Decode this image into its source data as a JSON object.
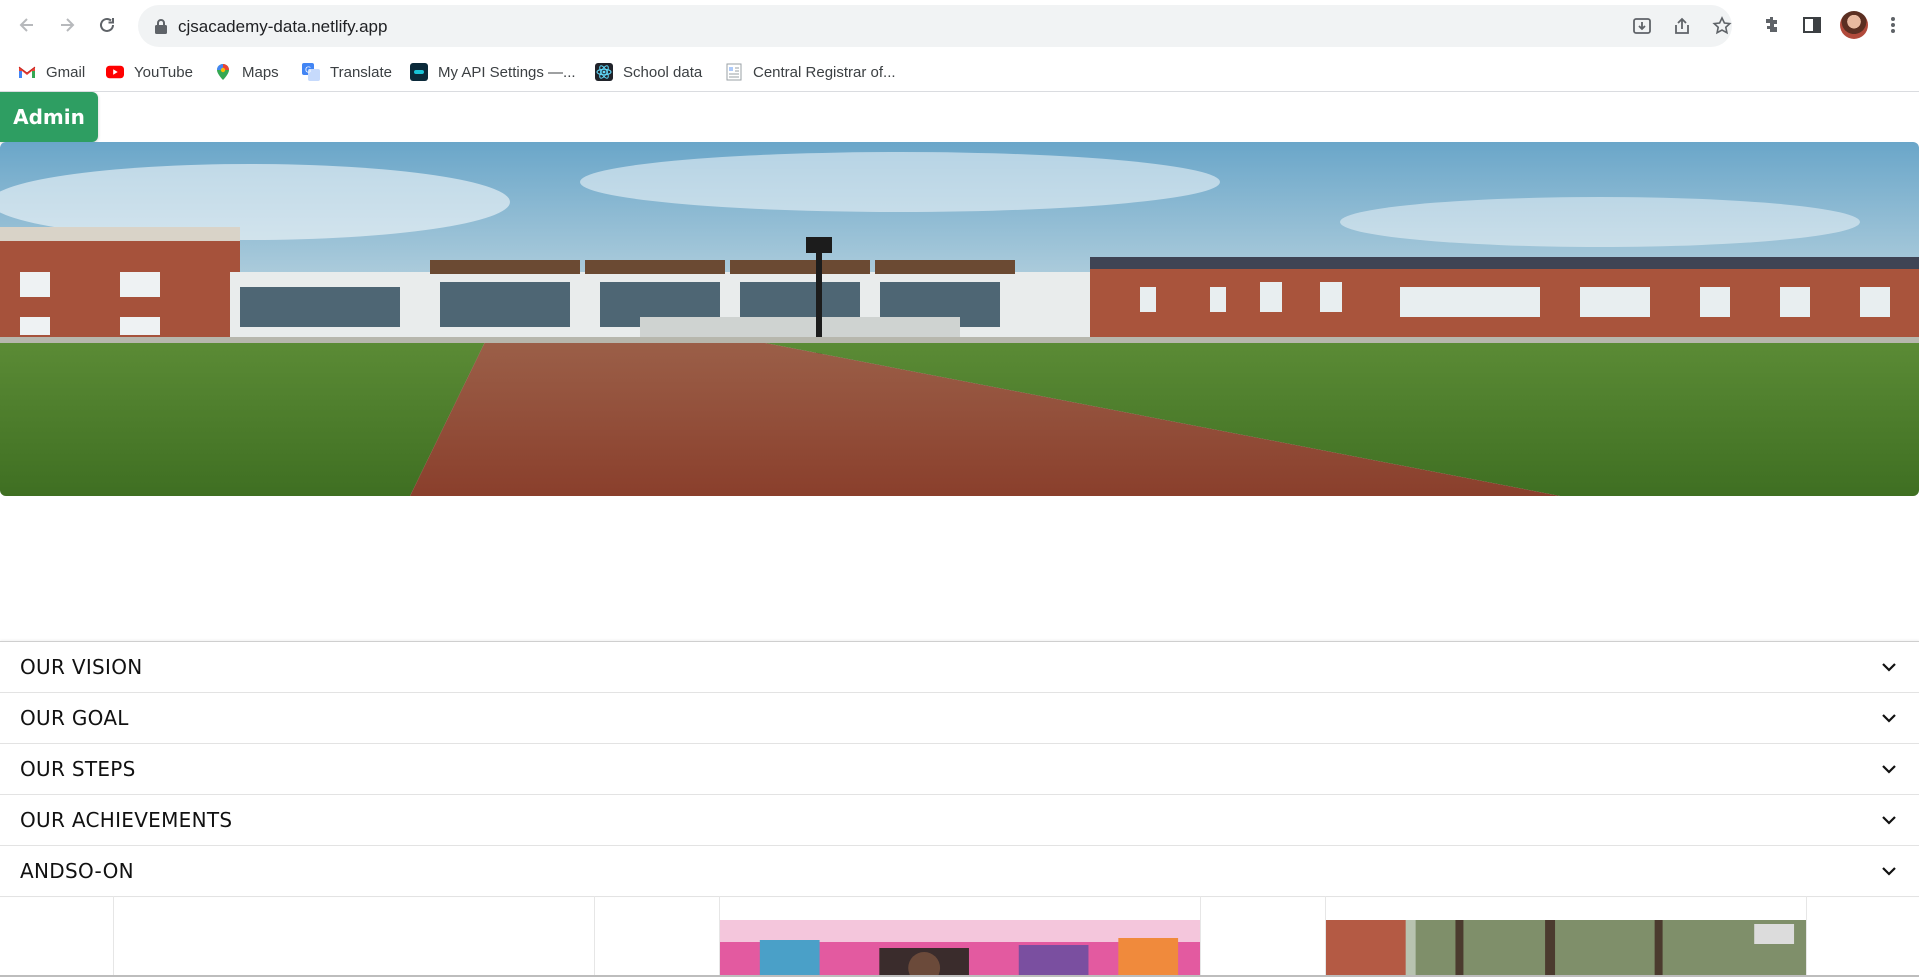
{
  "browser": {
    "url": "cjsacademy-data.netlify.app",
    "bookmarks": [
      {
        "label": "Gmail",
        "icon": "gmail-icon"
      },
      {
        "label": "YouTube",
        "icon": "youtube-icon"
      },
      {
        "label": "Maps",
        "icon": "maps-icon"
      },
      {
        "label": "Translate",
        "icon": "translate-icon"
      },
      {
        "label": "My API Settings —...",
        "icon": "api-icon"
      },
      {
        "label": "School data",
        "icon": "react-icon"
      },
      {
        "label": "Central Registrar of...",
        "icon": "document-icon"
      }
    ]
  },
  "page": {
    "admin_label": "Admin",
    "accordion": [
      {
        "label": "OUR VISION"
      },
      {
        "label": "OUR GOAL"
      },
      {
        "label": "OUR STEPS"
      },
      {
        "label": "OUR ACHIEVEMENTS"
      },
      {
        "label": "ANDSO-ON"
      }
    ]
  },
  "colors": {
    "admin_button": "#2e9e62",
    "omnibox": "#f1f3f4"
  }
}
